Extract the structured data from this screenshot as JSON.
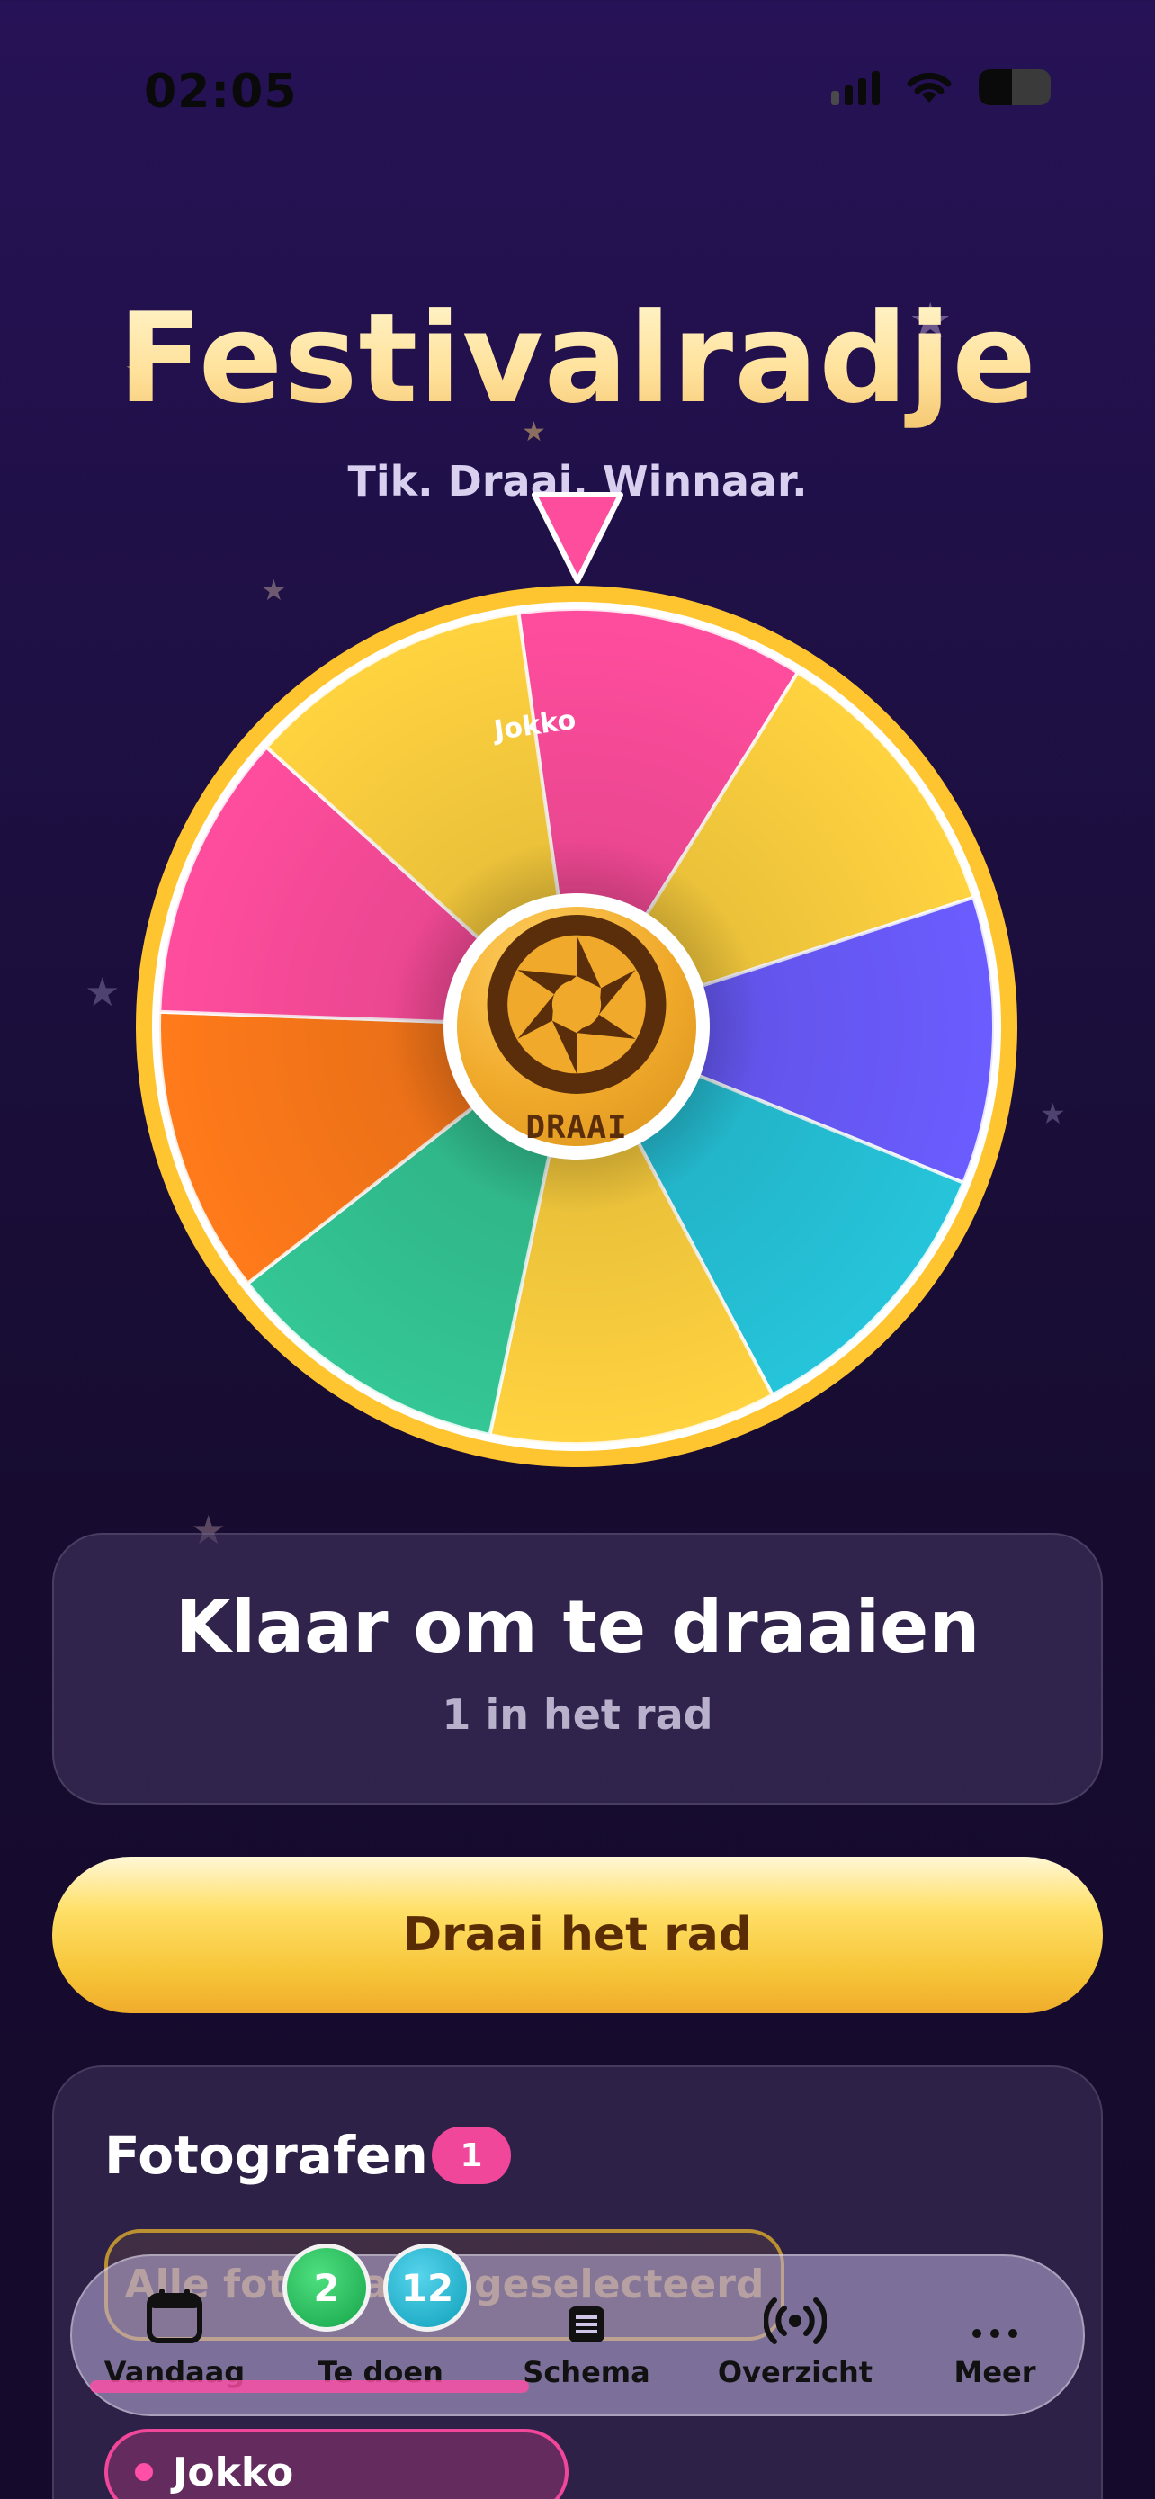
{
  "status_bar": {
    "time": "02:05"
  },
  "header": {
    "title": "Festivalradje",
    "subtitle": "Tik. Draai. Winnaar."
  },
  "wheel": {
    "spin_label": "DRAAI",
    "segment_label": "Jokko",
    "segment_colors": [
      "#ff4d9d",
      "#ffd23f",
      "#6b5cff",
      "#26c4da",
      "#ffd23f",
      "#34c695",
      "#ff7a1a",
      "#ff4d9d",
      "#ffd23f"
    ],
    "rim_color": "#ffc531"
  },
  "status_card": {
    "title": "Klaar om te draaien",
    "subtitle": "1 in het rad"
  },
  "spin_button": {
    "label": "Draai het rad"
  },
  "photographers": {
    "title": "Fotografen",
    "count": "1",
    "banner": "Alle fotografen geselecteerd",
    "people": [
      {
        "name": "Jokko",
        "dot_color": "#ff4fa6"
      }
    ]
  },
  "tab_bar": {
    "tabs": [
      {
        "label": "Vandaag",
        "icon": "calendar-icon"
      },
      {
        "label": "Te doen",
        "icon": "todo-icon"
      },
      {
        "label": "Schema",
        "icon": "list-icon"
      },
      {
        "label": "Overzicht",
        "icon": "broadcast-icon"
      },
      {
        "label": "Meer",
        "icon": "more-icon"
      }
    ],
    "badges": [
      "2",
      "12"
    ]
  }
}
